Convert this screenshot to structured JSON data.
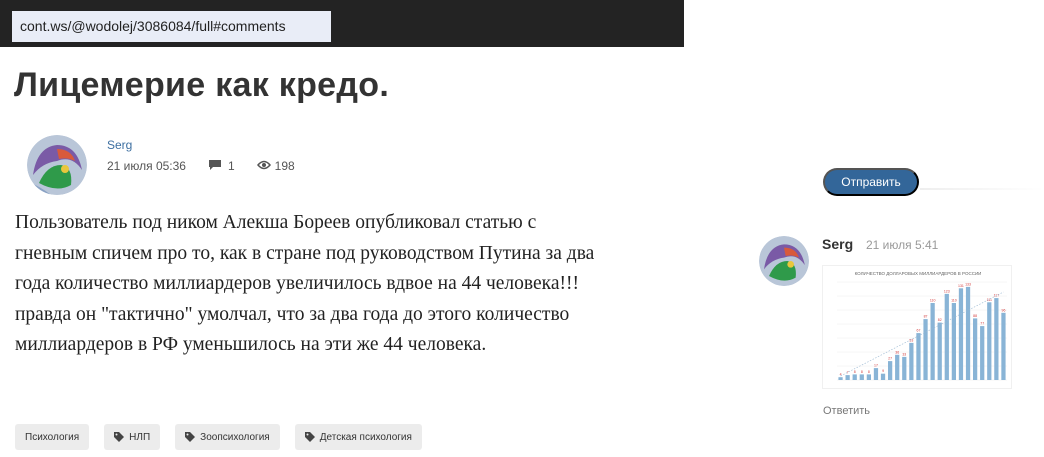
{
  "browser": {
    "url": "cont.ws/@wodolej/3086084/full#comments"
  },
  "article": {
    "title": "Лицемерие как кредо.",
    "author": "Serg",
    "date": "21 июля 05:36",
    "comments_count": "1",
    "views_count": "198",
    "paragraphs": [
      "Пользователь  под ником Алекша Бореев опубликовал статью с",
      "гневным спичем про то, как в стране под  руководством Путина за два",
      "года количество миллиардеров увеличилось вдвое на 44 человека!!!",
      "правда он \"тактично\" умолчал, что за два года до этого количество",
      "миллиардеров в РФ уменьшилось на эти же 44 человека."
    ]
  },
  "tags": [
    {
      "label": "Психология",
      "icon": ""
    },
    {
      "label": "НЛП",
      "icon": "tag-icon"
    },
    {
      "label": "Зоопсихология",
      "icon": "tag-icon"
    },
    {
      "label": "Детская психология",
      "icon": "tag-icon"
    }
  ],
  "sidebar": {
    "send_label": "Отправить"
  },
  "comment": {
    "author": "Serg",
    "date": "21 июля 5:41",
    "reply_label": "Ответить",
    "image": {
      "caption": "КОЛИЧЕСТВО ДОЛЛАРОВЫХ МИЛЛИАРДЕРОВ В РОССИИ",
      "bar_values": [
        4,
        7,
        8,
        8,
        8,
        17,
        9,
        27,
        36,
        33,
        53,
        67,
        87,
        110,
        82,
        123,
        110,
        131,
        133,
        88,
        77,
        111,
        117,
        96
      ]
    }
  },
  "colors": {
    "accent": "#336699",
    "author_link": "#3d6fa1",
    "topbar": "#232323",
    "bar": "#89b4d6"
  }
}
